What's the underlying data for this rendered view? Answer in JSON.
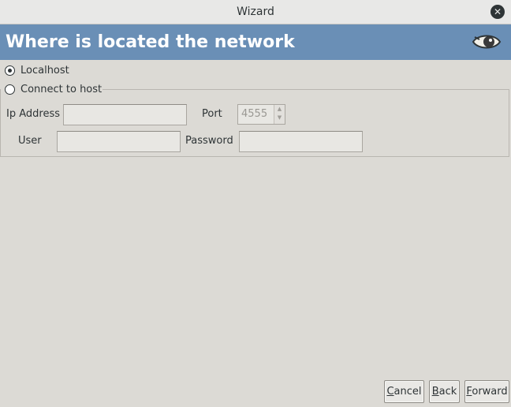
{
  "window": {
    "title": "Wizard"
  },
  "banner": {
    "heading": "Where is located the network"
  },
  "options": {
    "localhost_label": "Localhost",
    "localhost_selected": true,
    "remote_label": "Connect to host"
  },
  "fields": {
    "ip_label": "Ip Address",
    "ip_value": "",
    "port_label": "Port",
    "port_value": "4555",
    "user_label": "User",
    "user_value": "",
    "password_label": "Password",
    "password_value": ""
  },
  "buttons": {
    "cancel": {
      "mnemonic": "C",
      "rest": "ancel"
    },
    "back": {
      "mnemonic": "B",
      "rest": "ack"
    },
    "forward": {
      "mnemonic": "F",
      "rest": "orward"
    }
  },
  "colors": {
    "banner": "#6a8fb6",
    "window_bg": "#dcdad5"
  },
  "icons": {
    "close": "close-icon",
    "banner": "eye-icon"
  }
}
